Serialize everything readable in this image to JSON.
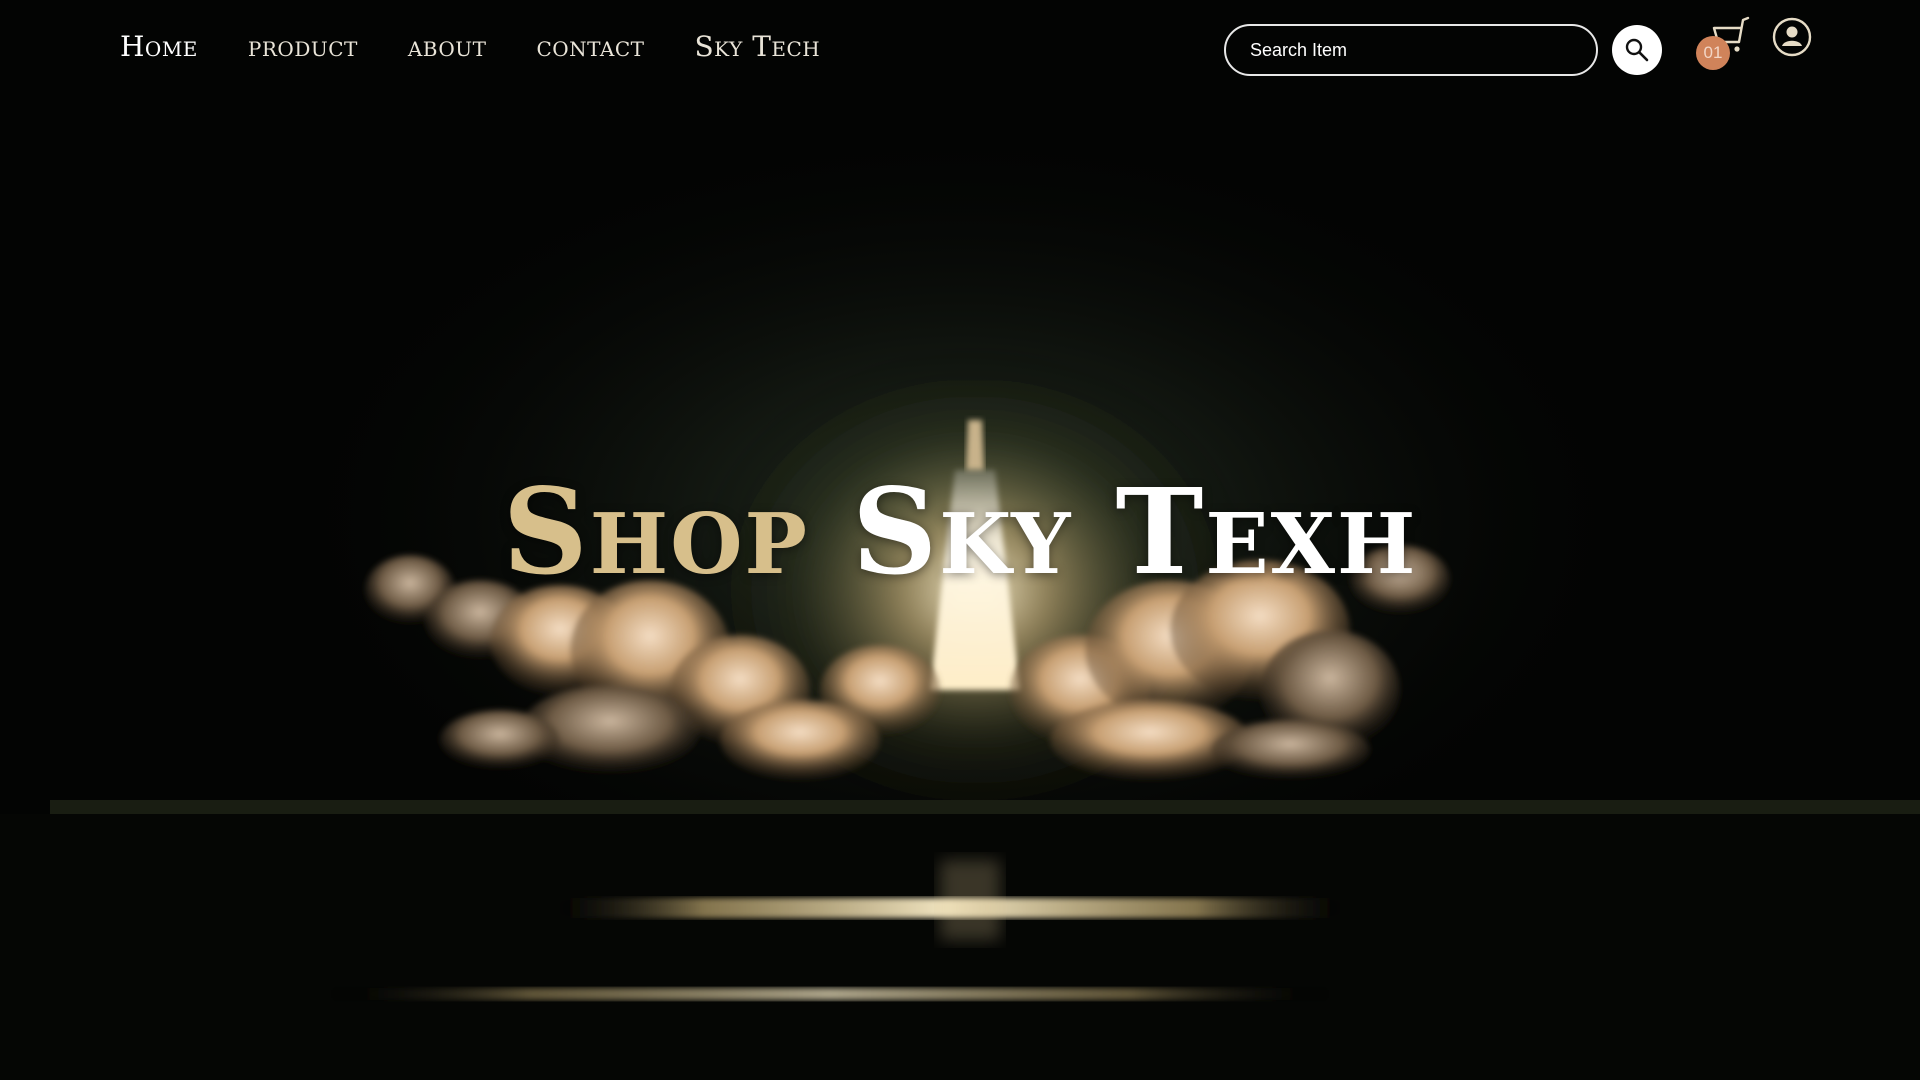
{
  "nav": {
    "items": [
      {
        "label": "Home",
        "active": true
      },
      {
        "label": "product",
        "active": false
      },
      {
        "label": "about",
        "active": false
      },
      {
        "label": "contact",
        "active": false
      },
      {
        "label": "Sky Tech",
        "active": false
      }
    ]
  },
  "search": {
    "placeholder": "Search Item",
    "value": "",
    "button_icon": "search-icon"
  },
  "cart": {
    "icon": "shopping-cart-icon",
    "count": "01"
  },
  "user": {
    "icon": "user-avatar-icon"
  },
  "hero": {
    "title_part1": "Shop",
    "title_part2": "Sky Texh",
    "background": "rocket-launch-night-photo"
  },
  "colors": {
    "accent_gold": "#d7bf8b",
    "badge": "#d0835a",
    "text_light": "#ffffff"
  }
}
